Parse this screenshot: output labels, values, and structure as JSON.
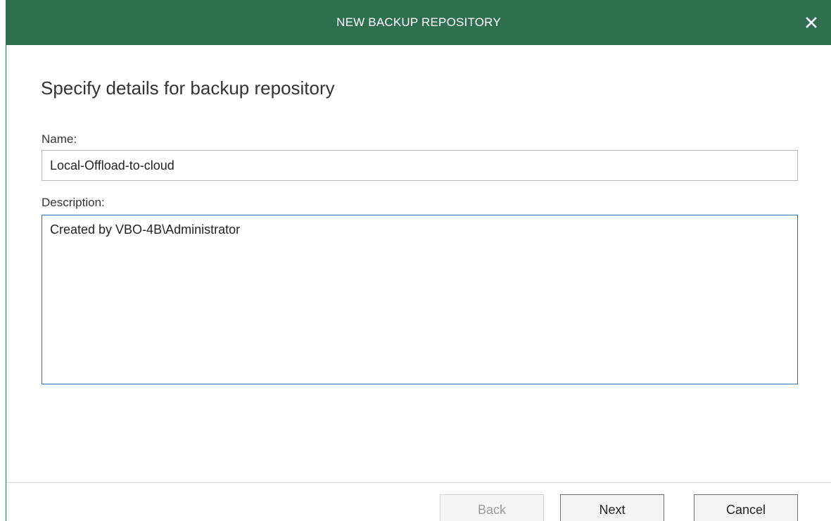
{
  "dialog": {
    "title": "NEW BACKUP REPOSITORY",
    "close_icon": "close-icon",
    "heading": "Specify details for backup repository"
  },
  "form": {
    "name_label": "Name:",
    "name_value": "Local-Offload-to-cloud",
    "description_label": "Description:",
    "description_value": "Created by VBO-4B\\Administrator"
  },
  "buttons": {
    "back": "Back",
    "next": "Next",
    "cancel": "Cancel"
  },
  "colors": {
    "titlebar": "#2d6f4e",
    "focus_border": "#2e6fb5"
  }
}
